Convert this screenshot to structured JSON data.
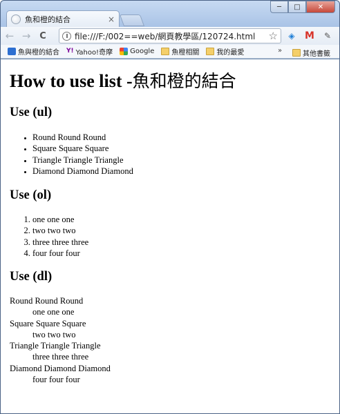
{
  "window": {
    "tab_title": "魚和橙的結合",
    "tab_close": "×",
    "btn_minimize": "─",
    "btn_maximize": "□",
    "btn_close": "✕"
  },
  "toolbar": {
    "back": "←",
    "forward": "→",
    "reload": "C",
    "url": "file:///F:/002==web/網頁教學區/120724.html",
    "star": "☆"
  },
  "bookmarks": {
    "items": [
      {
        "label": "魚與橙的結合",
        "icon": "blue-bookmark-icon"
      },
      {
        "label": "Yahoo!奇摩",
        "icon": "yahoo-icon"
      },
      {
        "label": "Google",
        "icon": "google-icon"
      },
      {
        "label": "魚橙相關",
        "icon": "folder-icon"
      },
      {
        "label": "我的最愛",
        "icon": "folder-icon"
      }
    ],
    "overflow": "»",
    "other": "其他書籤"
  },
  "page": {
    "title_latin": "How to use list -",
    "title_cjk": "魚和橙的結合",
    "ul_heading": "Use (ul)",
    "ul_items": [
      "Round Round Round",
      "Square Square Square",
      "Triangle Triangle Triangle",
      "Diamond Diamond Diamond"
    ],
    "ol_heading": "Use (ol)",
    "ol_items": [
      "one one one",
      "two two two",
      "three three three",
      "four four four"
    ],
    "dl_heading": "Use (dl)",
    "dl_items": [
      {
        "term": "Round Round Round",
        "desc": "one one one"
      },
      {
        "term": "Square Square Square",
        "desc": "two two two"
      },
      {
        "term": "Triangle Triangle Triangle",
        "desc": "three three three"
      },
      {
        "term": "Diamond Diamond Diamond",
        "desc": "four four four"
      }
    ]
  }
}
